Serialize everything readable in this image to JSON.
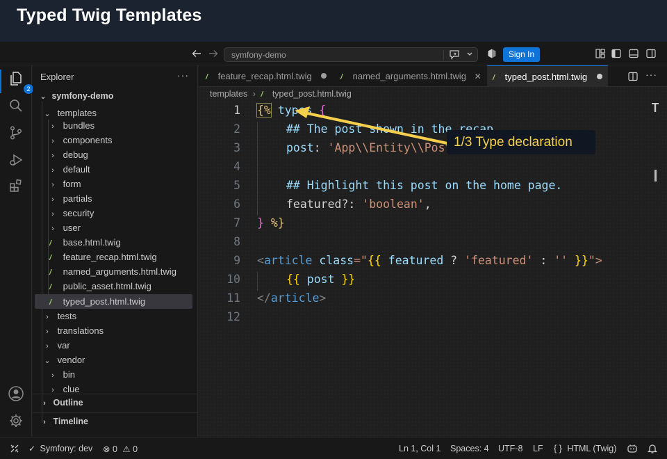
{
  "slide": {
    "title": "Typed Twig Templates"
  },
  "titlebar": {
    "search_text": "symfony-demo",
    "sign_in": "Sign In"
  },
  "activity": {
    "explorer_badge": "2"
  },
  "sidebar": {
    "heading": "Explorer",
    "more": "···",
    "project": "symfony-demo",
    "tree": [
      {
        "label": "templates",
        "kind": "folder-open"
      },
      {
        "label": "bundles",
        "kind": "folder"
      },
      {
        "label": "components",
        "kind": "folder"
      },
      {
        "label": "debug",
        "kind": "folder"
      },
      {
        "label": "default",
        "kind": "folder"
      },
      {
        "label": "form",
        "kind": "folder"
      },
      {
        "label": "partials",
        "kind": "folder"
      },
      {
        "label": "security",
        "kind": "folder"
      },
      {
        "label": "user",
        "kind": "folder"
      },
      {
        "label": "base.html.twig",
        "kind": "file"
      },
      {
        "label": "feature_recap.html.twig",
        "kind": "file"
      },
      {
        "label": "named_arguments.html.twig",
        "kind": "file"
      },
      {
        "label": "public_asset.html.twig",
        "kind": "file"
      },
      {
        "label": "typed_post.html.twig",
        "kind": "file"
      },
      {
        "label": "tests",
        "kind": "folder"
      },
      {
        "label": "translations",
        "kind": "folder"
      },
      {
        "label": "var",
        "kind": "folder"
      },
      {
        "label": "vendor",
        "kind": "folder-open"
      },
      {
        "label": "bin",
        "kind": "folder"
      },
      {
        "label": "clue",
        "kind": "folder"
      }
    ],
    "outline": "Outline",
    "timeline": "Timeline"
  },
  "editor": {
    "tabs": [
      {
        "label": "feature_recap.html.twig"
      },
      {
        "label": "named_arguments.html.twig"
      },
      {
        "label": "typed_post.html.twig"
      }
    ],
    "breadcrumb": {
      "folder": "templates",
      "file": "typed_post.html.twig"
    },
    "line_numbers": [
      "1",
      "2",
      "3",
      "4",
      "5",
      "6",
      "7",
      "8",
      "9",
      "10",
      "11",
      "12"
    ],
    "lines": {
      "l1": {
        "open": "{%",
        "kw": "types",
        "brace": "{"
      },
      "l2": {
        "comment": "## The post shown in the recap."
      },
      "l3": {
        "key": "post",
        "colon": ": ",
        "value": "'App\\\\Entity\\\\Post'",
        "comma": ","
      },
      "l5": {
        "comment": "## Highlight this post on the home page."
      },
      "l6": {
        "key": "featured?",
        "colon": ": ",
        "value": "'boolean'",
        "comma": ","
      },
      "l7": {
        "brace": "}",
        "close": " %}"
      },
      "l9": {
        "lt": "<",
        "tag": "article",
        "attr": " class",
        "eq": "=\"",
        "open": "{{",
        "var": " featured",
        "q": " ? ",
        "s1": "'featured'",
        "c": " : ",
        "s2": "''",
        "close": " }}",
        "end": "\">"
      },
      "l10": {
        "open": "{{",
        "var": " post",
        "close": " }}"
      },
      "l11": {
        "lt": "</",
        "tag": "article",
        "gt": ">"
      }
    },
    "callout": "1/3  Type declaration"
  },
  "status": {
    "branch": "Symfony: dev",
    "errors": "0",
    "warnings": "0",
    "position": "Ln 1, Col 1",
    "spaces": "Spaces: 4",
    "encoding": "UTF-8",
    "eol": "LF",
    "language": "HTML (Twig)"
  }
}
